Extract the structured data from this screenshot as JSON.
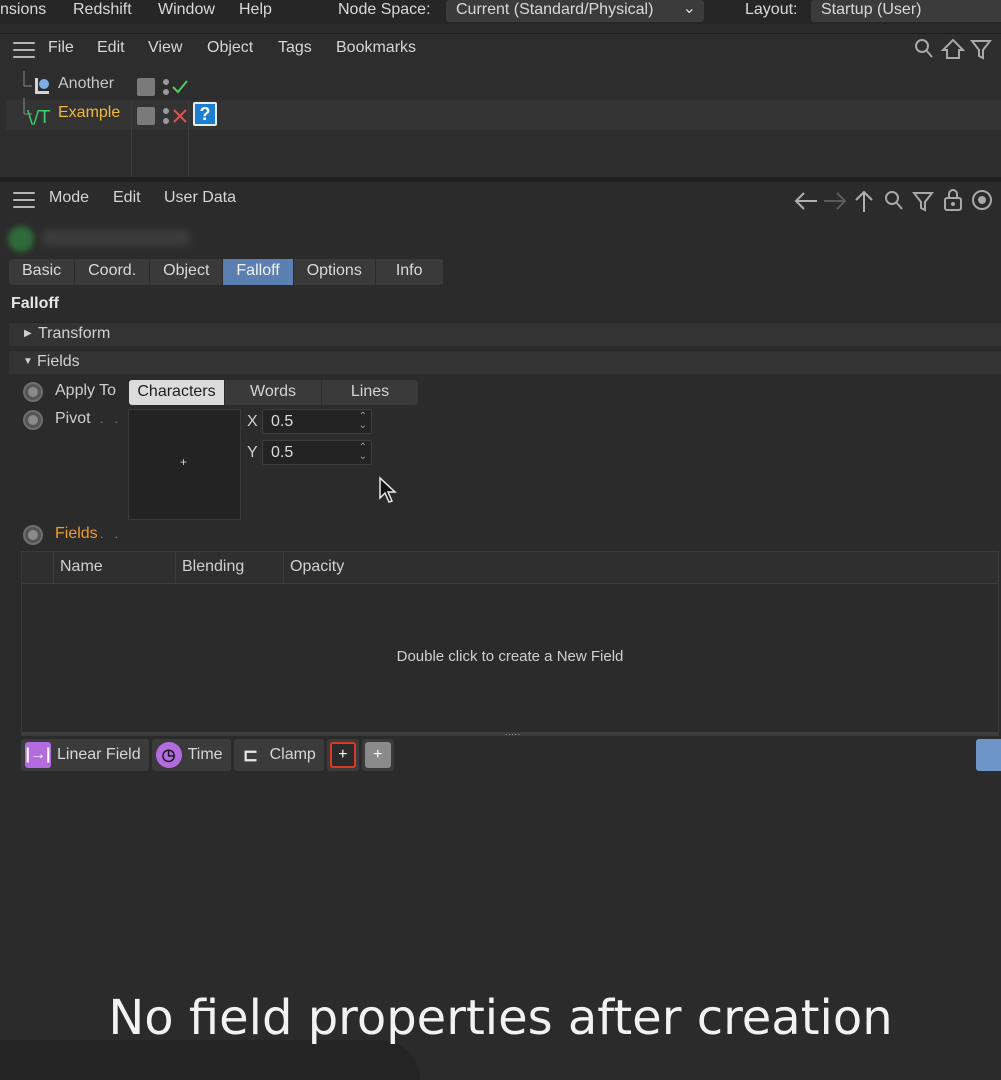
{
  "topbar": {
    "menus": [
      "nsions",
      "Redshift",
      "Window",
      "Help"
    ],
    "node_space_label": "Node Space:",
    "node_space_value": "Current (Standard/Physical)",
    "layout_label": "Layout:",
    "layout_value": "Startup (User)"
  },
  "object_manager": {
    "menus": [
      "File",
      "Edit",
      "View",
      "Object",
      "Tags",
      "Bookmarks"
    ],
    "objects": [
      {
        "name": "Another",
        "name_color": "#d0d0d0",
        "status": "check"
      },
      {
        "name": "Example",
        "name_color": "#f3b73a",
        "status": "cross",
        "tag": "?"
      }
    ],
    "icons": [
      "search-icon",
      "home-icon",
      "filter-icon"
    ]
  },
  "attribute_manager": {
    "menus": [
      "Mode",
      "Edit",
      "User Data"
    ],
    "icons": [
      "arrow-left-icon",
      "arrow-right-icon",
      "arrow-up-icon",
      "search-icon",
      "filter-icon",
      "lock-icon",
      "target-icon"
    ],
    "tabs": [
      "Basic",
      "Coord.",
      "Object",
      "Falloff",
      "Options",
      "Info"
    ],
    "active_tab": "Falloff",
    "section_title": "Falloff",
    "groups": {
      "transform": "Transform",
      "fields": "Fields"
    },
    "apply_to": {
      "label": "Apply To",
      "options": [
        "Characters",
        "Words",
        "Lines"
      ],
      "selected": "Characters"
    },
    "pivot": {
      "label": "Pivot",
      "x_label": "X",
      "x_value": "0.5",
      "y_label": "Y",
      "y_value": "0.5"
    },
    "fields_label": "Fields",
    "fields_label_color": "#f09a2e",
    "table": {
      "columns": [
        "Name",
        "Blending",
        "Opacity"
      ],
      "empty_text": "Double click to create a New Field"
    },
    "buttons": [
      "Linear Field",
      "Time",
      "Clamp"
    ]
  },
  "caption": "No field properties after creation"
}
